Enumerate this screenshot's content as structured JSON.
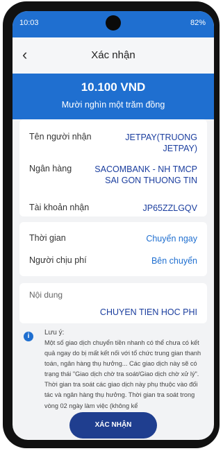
{
  "status": {
    "time": "10:03",
    "left_icons": "◘ ◘ ◘ •",
    "right_text": "82%"
  },
  "header": {
    "title": "Xác nhận",
    "back_glyph": "‹"
  },
  "transfer": {
    "amount": "10.100 VND",
    "amount_words": "Mười nghìn một trăm đồng"
  },
  "recipient": {
    "name_label": "Tên người nhận",
    "name_value": "JETPAY(TRUONG JETPAY)",
    "bank_label": "Ngân hàng",
    "bank_value": "SACOMBANK - NH TMCP SAI GON THUONG TIN",
    "account_label": "Tài khoản nhận",
    "account_value": "JP65ZZLGQV"
  },
  "details": {
    "time_label": "Thời gian",
    "time_value": "Chuyển ngay",
    "fee_label": "Người chịu phí",
    "fee_value": "Bên chuyển"
  },
  "content": {
    "label": "Nội dung",
    "value": "CHUYEN TIEN HOC PHI"
  },
  "note": {
    "title": "Lưu ý:",
    "body": "Một số giao dịch chuyển tiền nhanh có thể chưa có kết quả ngay do bị mất kết nối với tổ chức trung gian thanh toán, ngân hàng thụ hưởng... Các giao dịch này sẽ có trạng thái \"Giao dịch chờ tra soát/Giao dịch chờ xử lý\". Thời gian tra soát các giao dịch này phụ thuộc vào đối tác và ngân hàng thụ hưởng. Thời gian tra soát trong vòng 02 ngày làm việc (không kể"
  },
  "actions": {
    "confirm_label": "XÁC NHẬN"
  },
  "colors": {
    "primary": "#1f6fd0",
    "button": "#1f3e8f"
  }
}
